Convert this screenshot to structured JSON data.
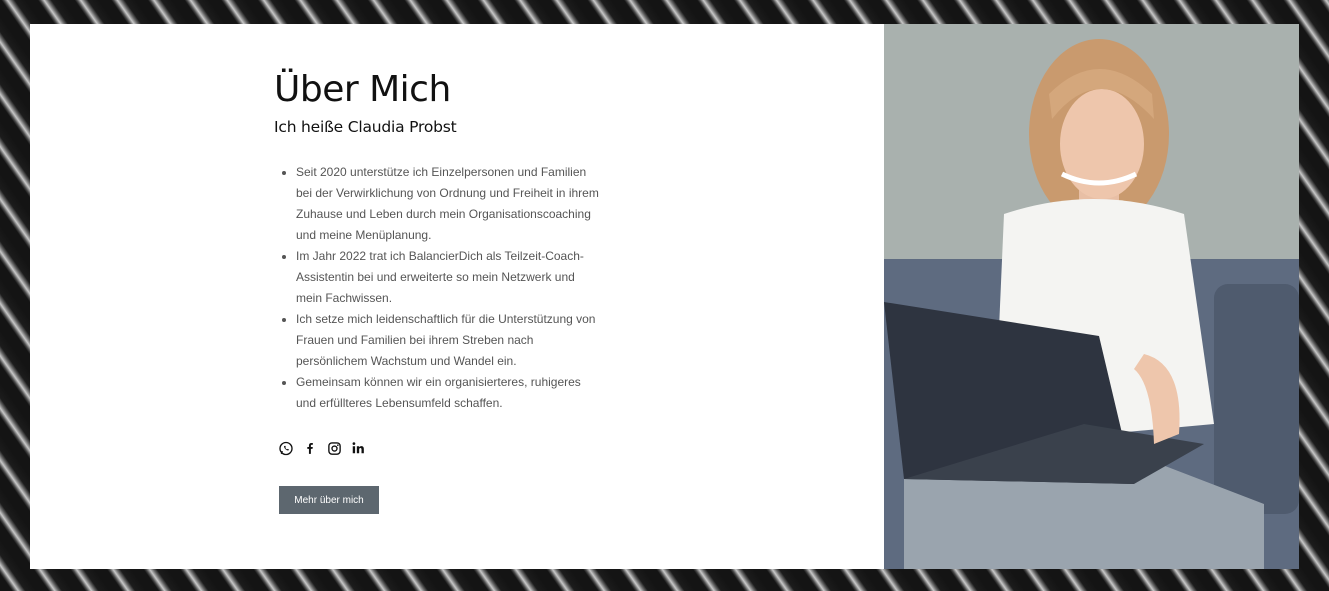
{
  "about": {
    "title": "Über Mich",
    "subtitle": "Ich heiße Claudia Probst",
    "bullets": [
      "Seit 2020 unterstütze ich Einzelpersonen und Familien bei der Verwirklichung von Ordnung und Freiheit in ihrem Zuhause und Leben durch mein Organisationscoaching und meine Menüplanung.",
      "Im Jahr 2022 trat ich BalancierDich als Teilzeit-Coach-Assistentin bei und erweiterte so mein Netzwerk und mein Fachwissen.",
      "Ich setze mich leidenschaftlich für die Unterstützung von Frauen und Familien bei ihrem Streben nach persönlichem Wachstum und Wandel ein.",
      "Gemeinsam können wir ein organisierteres, ruhigeres und erfüllteres Lebensumfeld schaffen."
    ],
    "button_label": "Mehr über mich"
  },
  "social": {
    "icons": [
      "whatsapp-icon",
      "facebook-icon",
      "instagram-icon",
      "linkedin-icon"
    ]
  },
  "colors": {
    "button_bg": "#5d676f",
    "card_bg": "#ffffff",
    "text_dark": "#111111",
    "text_body": "#555555"
  }
}
